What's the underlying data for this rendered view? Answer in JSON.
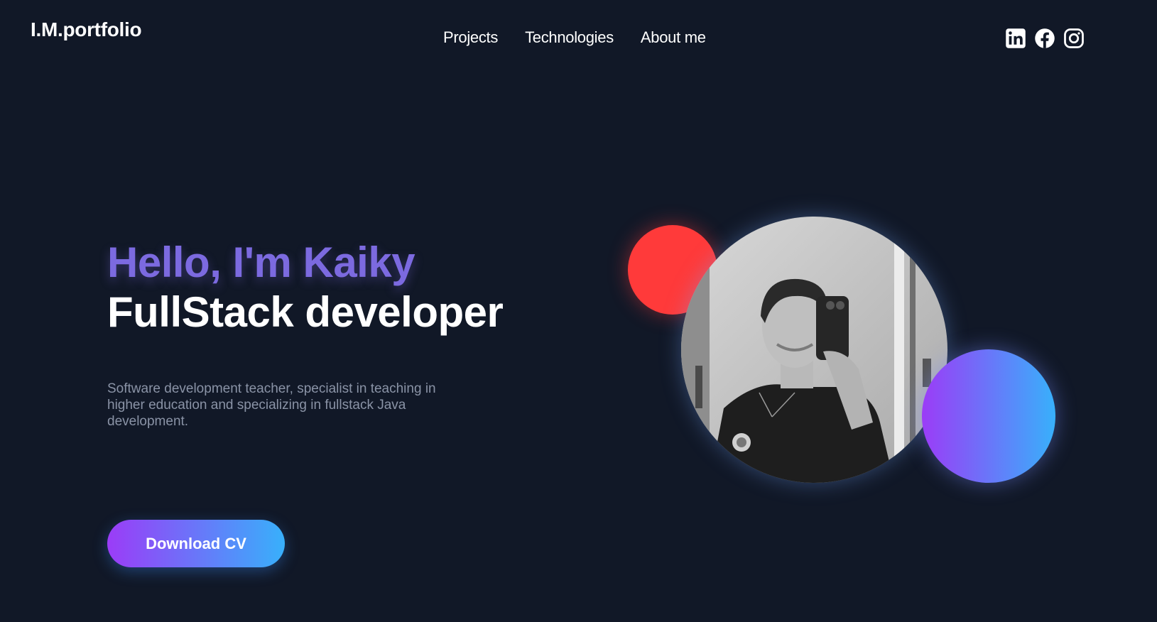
{
  "header": {
    "logo": "I.M.portfolio",
    "nav": [
      {
        "label": "Projects"
      },
      {
        "label": "Technologies"
      },
      {
        "label": "About me"
      }
    ],
    "socials": [
      {
        "icon": "linkedin-icon"
      },
      {
        "icon": "facebook-icon"
      },
      {
        "icon": "instagram-icon"
      }
    ]
  },
  "hero": {
    "greeting": "Hello, I'm Kaiky",
    "role": "FullStack developer",
    "description": "Software development teacher, specialist in teaching in higher education and specializing in fullstack Java development.",
    "cta_label": "Download CV"
  },
  "colors": {
    "background": "#111827",
    "greeting": "#7c6ae0",
    "accent_start": "#9b3cf7",
    "accent_end": "#38b0fb",
    "red_circle": "#ff3a3a"
  }
}
